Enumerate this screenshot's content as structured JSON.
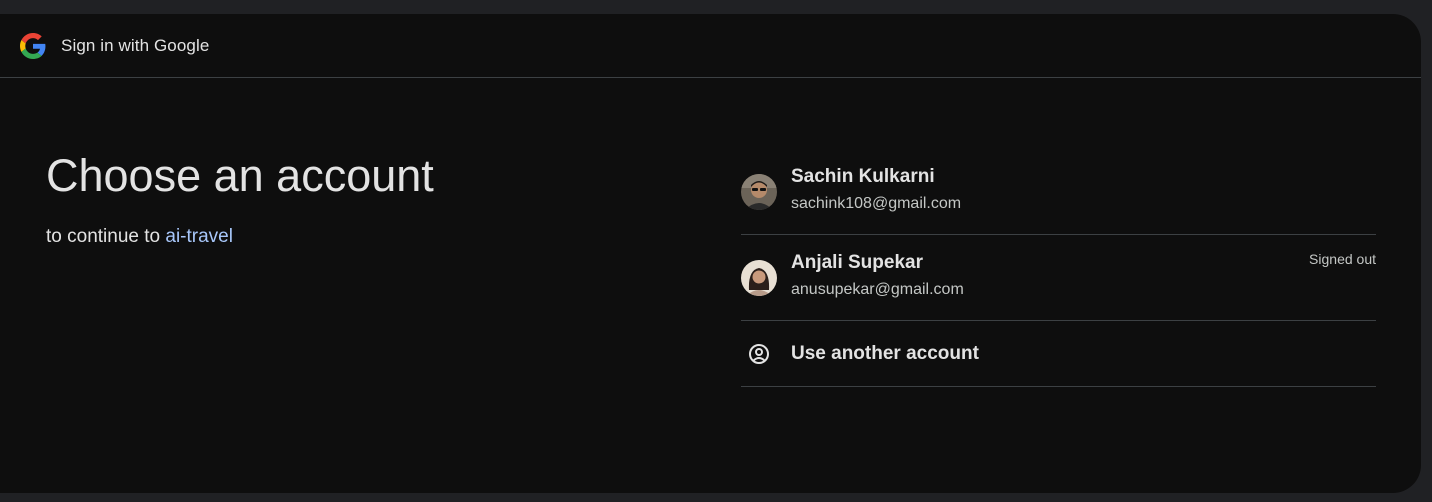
{
  "header": {
    "title": "Sign in with Google",
    "logo_icon": "google-g-icon"
  },
  "main": {
    "title": "Choose an account",
    "subtitle_prefix": "to continue to",
    "app_name": "ai-travel"
  },
  "accounts": [
    {
      "name": "Sachin Kulkarni",
      "email": "sachink108@gmail.com",
      "status": "",
      "avatar_icon": "profile-photo"
    },
    {
      "name": "Anjali Supekar",
      "email": "anusupekar@gmail.com",
      "status": "Signed out",
      "avatar_icon": "profile-photo"
    }
  ],
  "use_another": {
    "label": "Use another account",
    "icon": "account-circle-icon"
  },
  "colors": {
    "background": "#0e0e0e",
    "outer_background": "#202124",
    "text": "#e3e3e3",
    "secondary_text": "#c4c7c5",
    "link": "#a8c7fa",
    "divider": "#3c4043"
  }
}
